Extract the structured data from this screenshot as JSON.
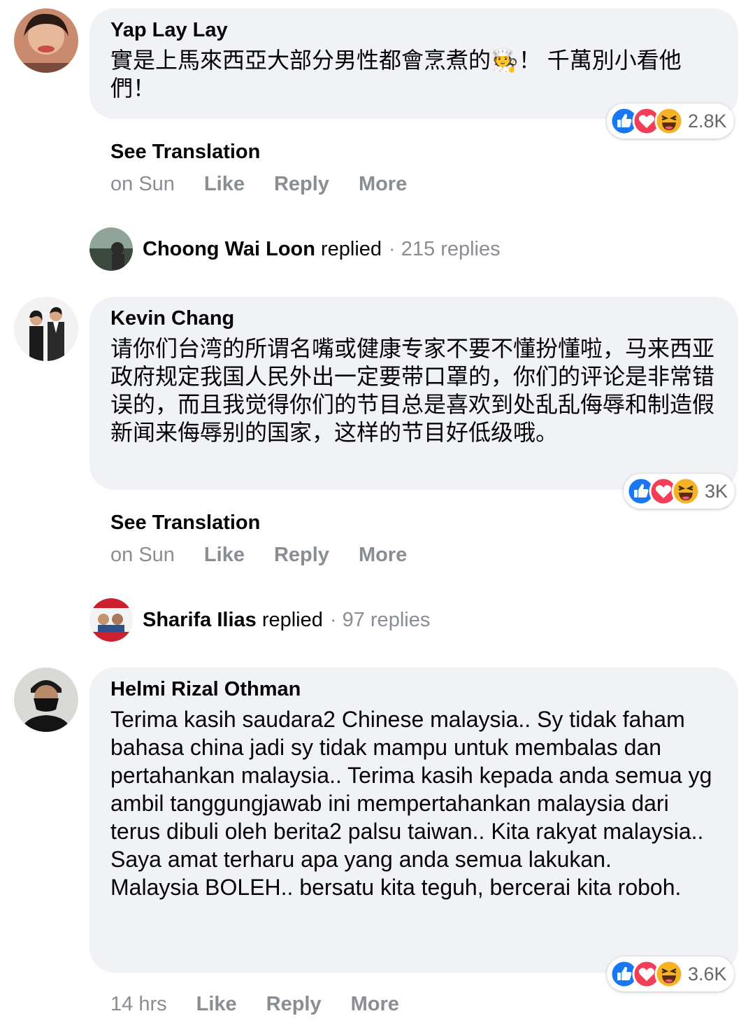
{
  "comments": [
    {
      "author": "Yap Lay Lay",
      "text": "實是上馬來西亞大部分男性都會烹煮的🧑‍🍳！ 千萬別小看他們！",
      "reaction_count": "2.8K",
      "see_translation": "See Translation",
      "time": "on Sun",
      "like": "Like",
      "reply": "Reply",
      "more": "More",
      "replied": {
        "name": "Choong Wai Loon",
        "word": "replied",
        "count": "· 215 replies"
      }
    },
    {
      "author": "Kevin Chang",
      "text": "请你们台湾的所谓名嘴或健康专家不要不懂扮懂啦，马来西亚政府规定我国人民外出一定要带口罩的，你们的评论是非常错误的，而且我觉得你们的节目总是喜欢到处乱乱侮辱和制造假新闻来侮辱别的国家，这样的节目好低级哦。",
      "reaction_count": "3K",
      "see_translation": "See Translation",
      "time": "on Sun",
      "like": "Like",
      "reply": "Reply",
      "more": "More",
      "replied": {
        "name": "Sharifa Ilias",
        "word": "replied",
        "count": "· 97 replies"
      }
    },
    {
      "author": "Helmi Rizal Othman",
      "text": "Terima kasih saudara2 Chinese malaysia.. Sy tidak faham bahasa china jadi sy tidak mampu untuk membalas dan pertahankan malaysia.. Terima kasih kepada anda semua yg ambil tanggungjawab ini mempertahankan malaysia dari terus dibuli oleh berita2 palsu taiwan.. Kita rakyat malaysia.. Saya amat terharu apa yang anda semua lakukan.\nMalaysia BOLEH.. bersatu kita teguh, bercerai kita roboh.",
      "reaction_count": "3.6K",
      "time": "14 hrs",
      "like": "Like",
      "reply": "Reply",
      "more": "More"
    }
  ],
  "reaction_icons": [
    "like-icon",
    "love-icon",
    "haha-icon"
  ],
  "colors": {
    "bubble": "#f0f2f5",
    "like_blue": "#1877f2",
    "love_red": "#f33e58",
    "haha_yellow": "#f7b125",
    "meta_gray": "#8a8d91"
  }
}
